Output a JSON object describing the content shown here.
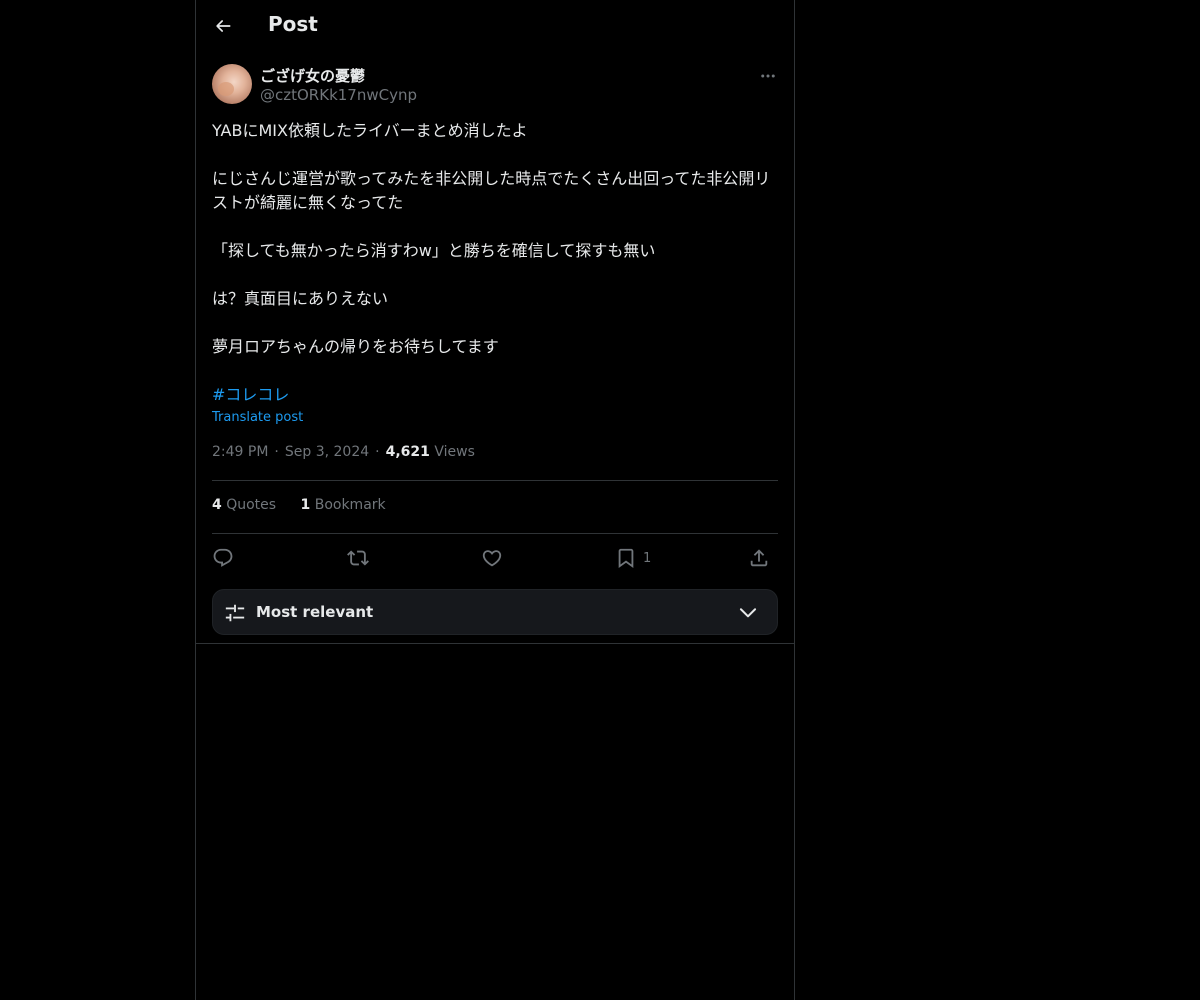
{
  "header": {
    "title": "Post"
  },
  "author": {
    "display_name": "ござげ女の憂鬱",
    "handle": "@cztORKk17nwCynp"
  },
  "post": {
    "paragraphs": [
      "YABにMIX依頼したライバーまとめ消したよ",
      "にじさんじ運営が歌ってみたを非公開した時点でたくさん出回ってた非公開リストが綺麗に無くなってた",
      "「探しても無かったら消すわw」と勝ちを確信して探すも無い",
      "は？真面目にありえない",
      "夢月ロアちゃんの帰りをお待ちしてます"
    ],
    "hashtag": "#コレコレ",
    "translate_label": "Translate post",
    "time": "2:49 PM",
    "date": "Sep 3, 2024",
    "views_count": "4,621",
    "views_label": "Views"
  },
  "stats": {
    "quotes_count": "4",
    "quotes_label": "Quotes",
    "bookmarks_count": "1",
    "bookmarks_label": "Bookmark"
  },
  "actions": {
    "reply_icon": "reply-icon",
    "repost_icon": "repost-icon",
    "like_icon": "heart-icon",
    "bookmark_icon": "bookmark-icon",
    "bookmark_count": "1",
    "share_icon": "share-icon"
  },
  "sort": {
    "label": "Most relevant"
  },
  "colors": {
    "background": "#000000",
    "text": "#e7e9ea",
    "muted": "#71767b",
    "accent": "#1d9bf0",
    "border": "#2f3336"
  }
}
